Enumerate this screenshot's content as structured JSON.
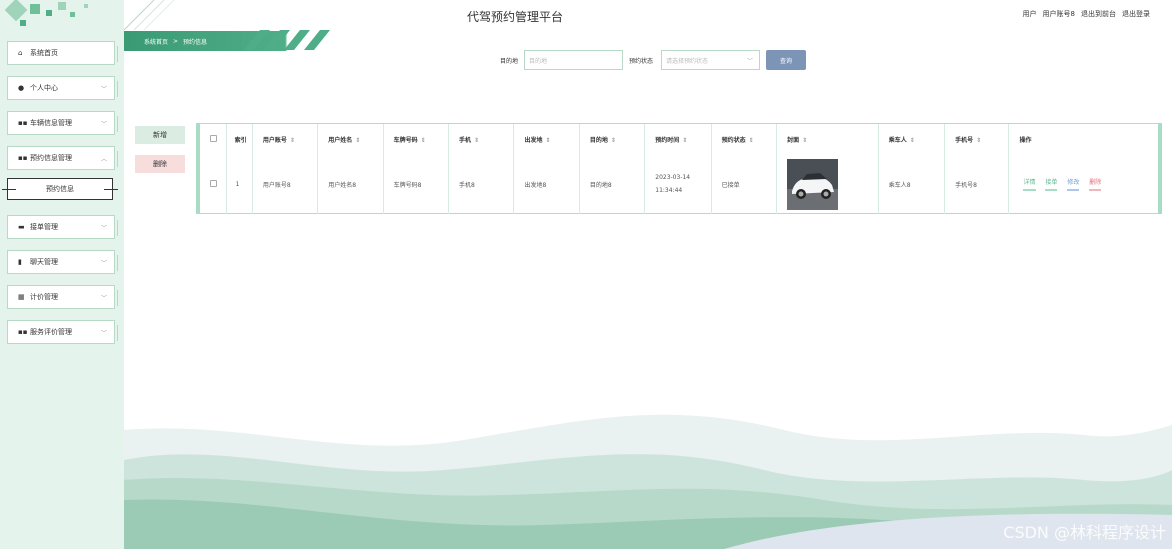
{
  "header": {
    "title": "代驾预约管理平台",
    "user_role": "用户",
    "user_name": "用户账号8",
    "back_to_front": "退出到前台",
    "logout": "退出登录"
  },
  "breadcrumb": {
    "home": "系统首页",
    "separator": ">",
    "current": "预约信息"
  },
  "sidebar": {
    "items": [
      {
        "label": "系统首页",
        "icon": "home-icon"
      },
      {
        "label": "个人中心",
        "icon": "user-icon"
      },
      {
        "label": "车辆信息管理",
        "icon": "grid-icon"
      },
      {
        "label": "预约信息管理",
        "icon": "grid-icon"
      },
      {
        "label": "接单管理",
        "icon": "message-icon"
      },
      {
        "label": "聊天管理",
        "icon": "clipboard-icon"
      },
      {
        "label": "计价管理",
        "icon": "table-icon"
      },
      {
        "label": "服务评价管理",
        "icon": "grid-icon"
      }
    ],
    "sub_item": "预约信息"
  },
  "search": {
    "destination_label": "目的地",
    "destination_placeholder": "目的地",
    "status_label": "预约状态",
    "status_placeholder": "请选择预约状态",
    "query_button": "查询"
  },
  "actions": {
    "add": "新增",
    "delete": "删除"
  },
  "table": {
    "columns": [
      "索引",
      "用户账号",
      "用户姓名",
      "车牌号码",
      "手机",
      "出发地",
      "目的地",
      "预约时间",
      "预约状态",
      "封面",
      "乘车人",
      "手机号",
      "操作"
    ],
    "rows": [
      {
        "index": "1",
        "account": "用户账号8",
        "name": "用户姓名8",
        "plate": "车牌号码8",
        "phone": "手机8",
        "origin": "出发地8",
        "destination": "目的地8",
        "time_date": "2023-03-14",
        "time_clock": "11:34:44",
        "status": "已接单",
        "passenger": "乘车人8",
        "passenger_phone": "手机号8",
        "ops": [
          "详情",
          "接单",
          "修改",
          "删除"
        ]
      }
    ]
  },
  "colors": {
    "accent": "#4fae87",
    "sidebar_bg": "#e4f4ec",
    "query_button": "#7c95b6",
    "op_detail": "#5cb88e",
    "op_accept": "#5cb88e",
    "op_edit": "#6a9fd8",
    "op_delete": "#e0707a"
  },
  "watermark": "CSDN @林科程序设计"
}
